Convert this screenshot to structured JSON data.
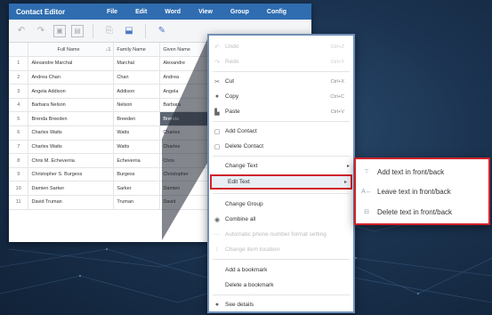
{
  "app": {
    "title": "Contact Editor",
    "menu": [
      "File",
      "Edit",
      "Word",
      "View",
      "Group",
      "Config"
    ]
  },
  "toolbar": {
    "icons": [
      "undo-icon",
      "redo-icon",
      "add-contact-icon",
      "remove-contact-icon",
      "copy-icon",
      "paste-icon",
      "edit-icon"
    ]
  },
  "table": {
    "sort_indicator": "↓1",
    "columns": [
      "Full Name",
      "Family Name",
      "Given Name"
    ],
    "rows": [
      {
        "num": "1",
        "full": "Alexandre Marchal",
        "family": "Marchal",
        "given": "Alexandre"
      },
      {
        "num": "2",
        "full": "Andrea Chan",
        "family": "Chan",
        "given": "Andrea"
      },
      {
        "num": "3",
        "full": "Angela Addison",
        "family": "Addison",
        "given": "Angela"
      },
      {
        "num": "4",
        "full": "Barbara Nelson",
        "family": "Nelson",
        "given": "Barbara"
      },
      {
        "num": "5",
        "full": "Brenda Breeden",
        "family": "Breeden",
        "given": "Brenda"
      },
      {
        "num": "6",
        "full": "Charles Watts",
        "family": "Watts",
        "given": "Charles"
      },
      {
        "num": "7",
        "full": "Charles Watts",
        "family": "Watts",
        "given": "Charles"
      },
      {
        "num": "8",
        "full": "Chris M. Echeverria",
        "family": "Echeverria",
        "given": "Chris"
      },
      {
        "num": "9",
        "full": "Christopher S. Burgess",
        "family": "Burgess",
        "given": "Christopher"
      },
      {
        "num": "10",
        "full": "Damien Sarker",
        "family": "Sarker",
        "given": "Damien"
      },
      {
        "num": "11",
        "full": "David Truman",
        "family": "Truman",
        "given": "David"
      }
    ]
  },
  "context_menu": {
    "undo": {
      "label": "Undo",
      "shortcut": "Ctrl+Z"
    },
    "redo": {
      "label": "Redo",
      "shortcut": "Ctrl+Y"
    },
    "cut": {
      "label": "Cut",
      "shortcut": "Ctrl+X"
    },
    "copy": {
      "label": "Copy",
      "shortcut": "Ctrl+C"
    },
    "paste": {
      "label": "Paste",
      "shortcut": "Ctrl+V"
    },
    "add_contact": "Add Contact",
    "delete_contact": "Delete Contact",
    "change_text": "Change Text",
    "edit_text": "Edit Text",
    "change_group": "Change Group",
    "combine_all": "Combine all",
    "auto_phone": "Automatic phone number format setting",
    "change_location": "Change item location",
    "add_bookmark": "Add a bookmark",
    "delete_bookmark": "Delete a bookmark",
    "see_details": "See details"
  },
  "submenu": {
    "add_text": "Add text in front/back",
    "leave_text": "Leave text in front/back",
    "delete_text": "Delete text in front/back"
  },
  "colors": {
    "menubar": "#2f6db0",
    "highlight_border": "#d0222a",
    "menu_border": "#6f8fb8"
  }
}
